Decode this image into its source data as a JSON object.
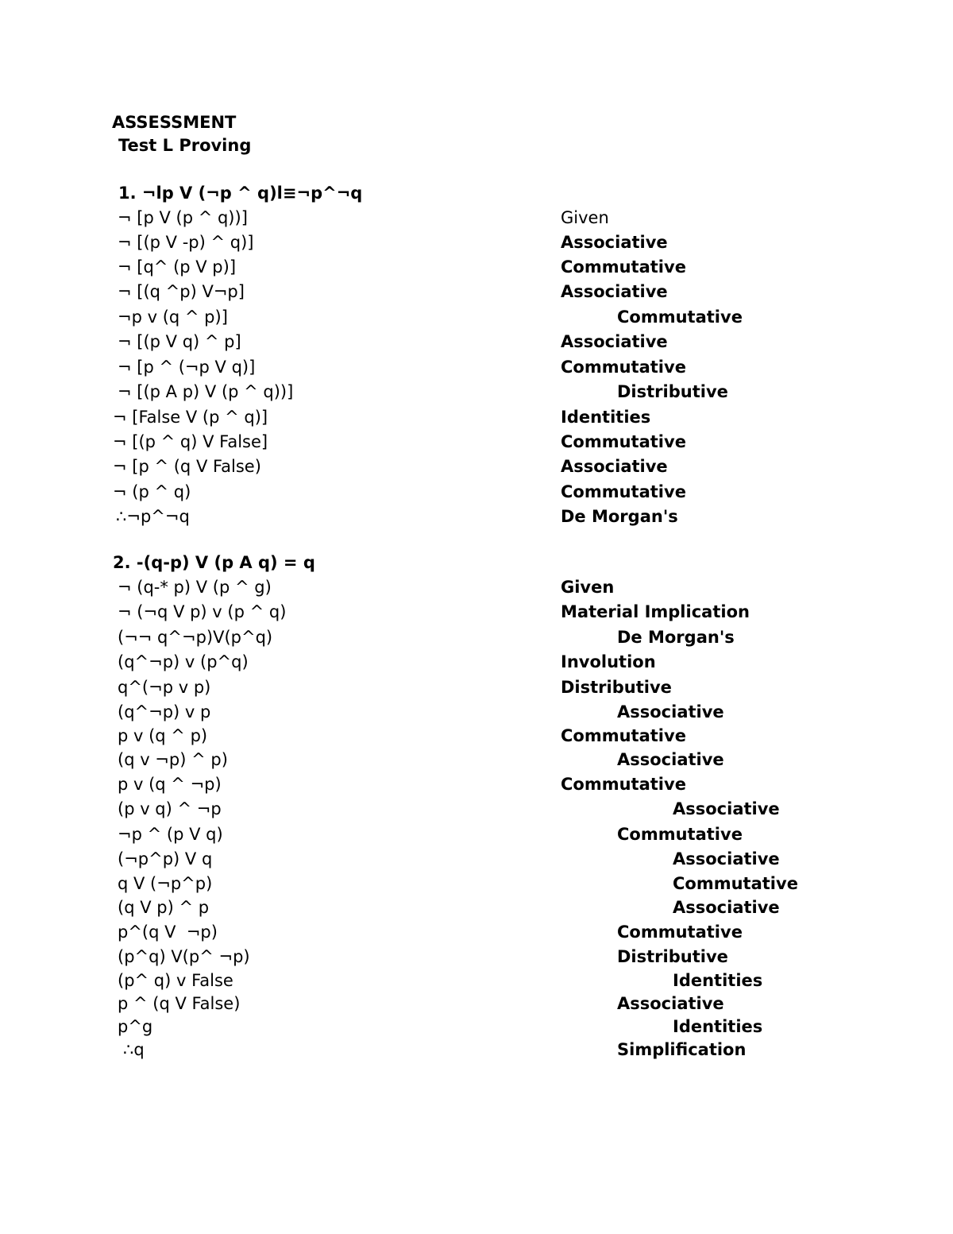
{
  "document": {
    "title": "ASSESSMENT",
    "subtitle": "Test L Proving",
    "problems": [
      {
        "heading": "1. ¬lp V (¬p ^ q)l≡¬p^¬q",
        "steps": [
          {
            "expr": "¬ [p V (p ^ q))]",
            "rule": "Given"
          },
          {
            "expr": "¬ [(p V -p) ^ q)]",
            "rule": "Associative"
          },
          {
            "expr": "¬ [q^ (p V p)]",
            "rule": "Commutative"
          },
          {
            "expr": "¬ [(q ^p) V¬p]",
            "rule": "Associative"
          },
          {
            "expr": "¬p v (q ^ p)]",
            "rule": "Commutative"
          },
          {
            "expr": "¬ [(p V q) ^ p]",
            "rule": "Associative"
          },
          {
            "expr": "¬ [p ^ (¬p V q)]",
            "rule": "Commutative"
          },
          {
            "expr": "¬ [(p A p) V (p ^ q))]",
            "rule": "Distributive"
          },
          {
            "expr": "¬ [False V (p ^ q)]",
            "rule": "Identities"
          },
          {
            "expr": "¬ [(p ^ q) V False]",
            "rule": "Commutative"
          },
          {
            "expr": "¬ [p ^ (q V False)",
            "rule": "Associative"
          },
          {
            "expr": "¬ (p ^ q)",
            "rule": "Commutative"
          },
          {
            "expr": "∴¬p^¬q",
            "rule": "De Morgan's"
          }
        ]
      },
      {
        "heading": "2. -(q-p) V (p A q) = q",
        "steps": [
          {
            "expr": "¬ (q-* p) V (p ^ g)",
            "rule": "Given"
          },
          {
            "expr": "¬ (¬q V p) v (p ^ q)",
            "rule": "Material Implication"
          },
          {
            "expr": "(¬¬ q^¬p)V(p^q)",
            "rule": "De Morgan's"
          },
          {
            "expr": "(q^¬p) v (p^q)",
            "rule": "Involution"
          },
          {
            "expr": "q^(¬p v p)",
            "rule": "Distributive"
          },
          {
            "expr": "(q^¬p) v p",
            "rule": "Associative"
          },
          {
            "expr": "p v (q ^ p)",
            "rule": "Commutative"
          },
          {
            "expr": "(q v ¬p) ^ p)",
            "rule": "Associative"
          },
          {
            "expr": "p v (q ^ ¬p)",
            "rule": "Commutative"
          },
          {
            "expr": "(p v q) ^ ¬p",
            "rule": "Associative"
          },
          {
            "expr": "¬p ^ (p V q)",
            "rule": "Commutative"
          },
          {
            "expr": "(¬p^p) V q",
            "rule": "Associative"
          },
          {
            "expr": "q V (¬p^p)",
            "rule": "Commutative"
          },
          {
            "expr": "(q V p) ^ p",
            "rule": "Associative"
          },
          {
            "expr": "p^(q V  ¬p)",
            "rule": "Commutative"
          },
          {
            "expr": "(p^q) V(p^ ¬p)",
            "rule": "Distributive"
          },
          {
            "expr": "(p^ q) v False",
            "rule": "Identities"
          },
          {
            "expr": "p ^ (q V False)",
            "rule": "Associative"
          },
          {
            "expr": "p^g",
            "rule": "Identities"
          },
          {
            "expr": "∴q",
            "rule": "Simplification"
          }
        ]
      }
    ]
  }
}
